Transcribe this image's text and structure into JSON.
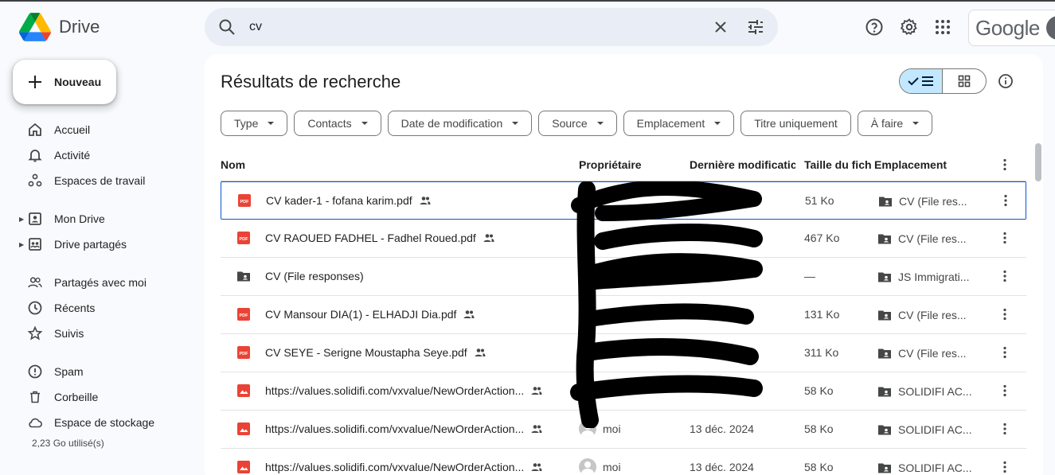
{
  "app": {
    "name": "Drive",
    "account_brand": "Google"
  },
  "search": {
    "value": "cv"
  },
  "sidebar": {
    "new_label": "Nouveau",
    "items": [
      {
        "label": "Accueil",
        "icon": "home-icon"
      },
      {
        "label": "Activité",
        "icon": "bell-icon"
      },
      {
        "label": "Espaces de travail",
        "icon": "workspaces-icon"
      },
      {
        "label": "Mon Drive",
        "icon": "my-drive-icon"
      },
      {
        "label": "Drive partagés",
        "icon": "shared-drives-icon"
      },
      {
        "label": "Partagés avec moi",
        "icon": "people-icon"
      },
      {
        "label": "Récents",
        "icon": "clock-icon"
      },
      {
        "label": "Suivis",
        "icon": "star-icon"
      },
      {
        "label": "Spam",
        "icon": "spam-icon"
      },
      {
        "label": "Corbeille",
        "icon": "trash-icon"
      },
      {
        "label": "Espace de stockage",
        "icon": "cloud-icon"
      }
    ],
    "storage_used": "2,23 Go utilisé(s)"
  },
  "main": {
    "title": "Résultats de recherche",
    "filters": [
      "Type",
      "Contacts",
      "Date de modification",
      "Source",
      "Emplacement",
      "Titre uniquement",
      "À faire"
    ],
    "columns": {
      "name": "Nom",
      "owner": "Propriétaire",
      "modified": "Dernière modificatic",
      "size": "Taille du fich",
      "location": "Emplacement"
    },
    "rows": [
      {
        "name": "CV kader-1 - fofana karim.pdf",
        "type": "pdf",
        "owner": "",
        "modified": "",
        "size": "51 Ko",
        "location": "CV (File res...",
        "shared": true
      },
      {
        "name": "CV RAOUED FADHEL - Fadhel Roued.pdf",
        "type": "pdf",
        "owner": "",
        "modified": "",
        "size": "467 Ko",
        "location": "CV (File res...",
        "shared": true
      },
      {
        "name": "CV (File responses)",
        "type": "folder",
        "owner": "",
        "modified": "",
        "size": "—",
        "location": "JS Immigrati...",
        "shared": false
      },
      {
        "name": "CV Mansour DIA(1) - ELHADJI Dia.pdf",
        "type": "pdf",
        "owner": "",
        "modified": "",
        "size": "131 Ko",
        "location": "CV (File res...",
        "shared": true
      },
      {
        "name": "CV SEYE - Serigne Moustapha Seye.pdf",
        "type": "pdf",
        "owner": "",
        "modified": "",
        "size": "311 Ko",
        "location": "CV (File res...",
        "shared": true
      },
      {
        "name": "https://values.solidifi.com/vxvalue/NewOrderAction...",
        "type": "image",
        "owner": "",
        "modified": "",
        "size": "58 Ko",
        "location": "SOLIDIFI AC...",
        "shared": true
      },
      {
        "name": "https://values.solidifi.com/vxvalue/NewOrderAction...",
        "type": "image",
        "owner": "moi",
        "modified": "13 déc. 2024",
        "size": "58 Ko",
        "location": "SOLIDIFI AC...",
        "shared": true
      },
      {
        "name": "https://values.solidifi.com/vxvalue/NewOrderAction...",
        "type": "image",
        "owner": "moi",
        "modified": "13 déc. 2024",
        "size": "58 Ko",
        "location": "SOLIDIFI AC...",
        "shared": true
      }
    ]
  },
  "colors": {
    "accent": "#0b57d0",
    "pdf_red": "#ea4335",
    "toggle_active": "#c2e7ff"
  }
}
